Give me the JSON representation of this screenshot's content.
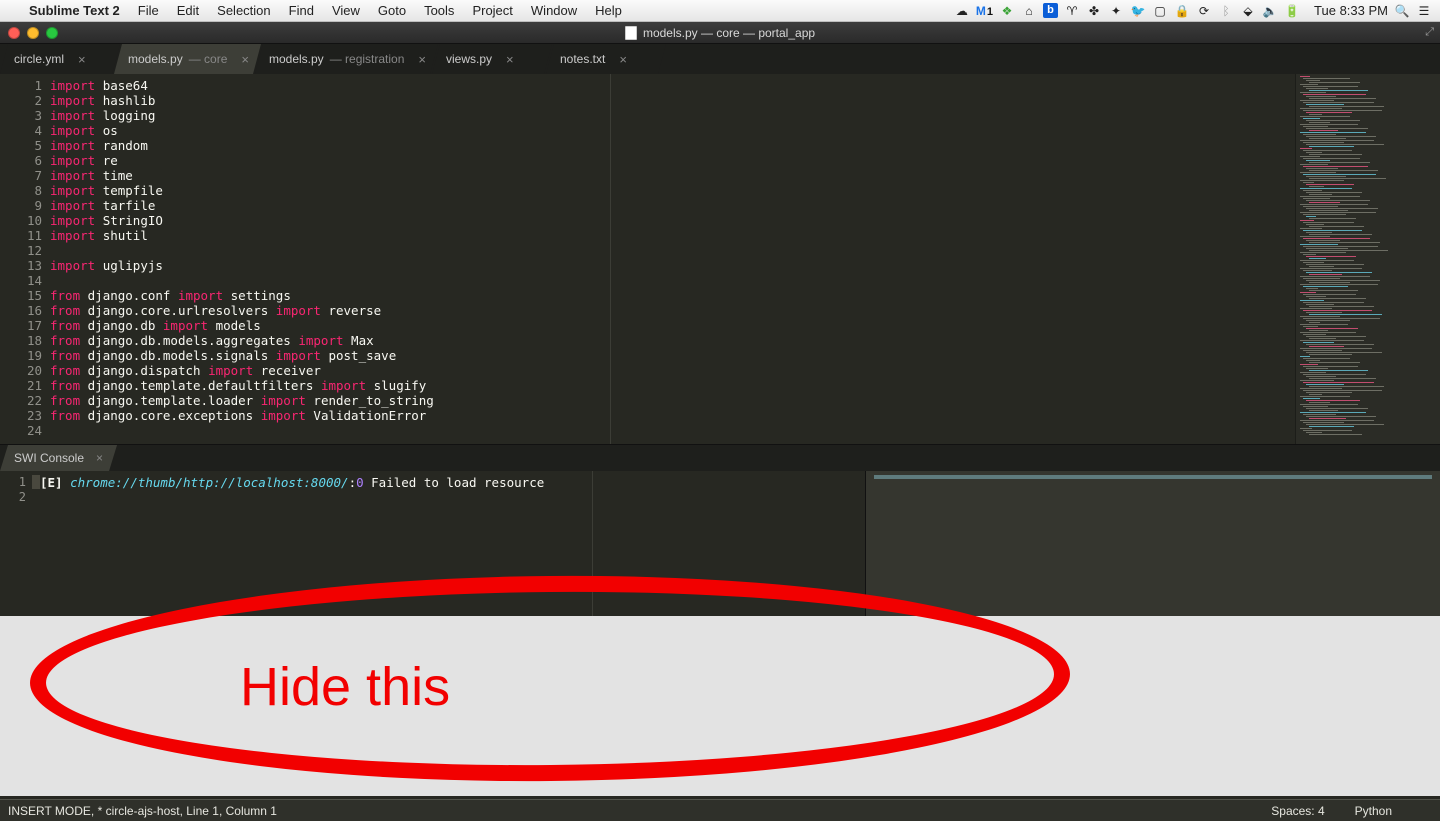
{
  "menubar": {
    "app": "Sublime Text 2",
    "items": [
      "File",
      "Edit",
      "Selection",
      "Find",
      "View",
      "Goto",
      "Tools",
      "Project",
      "Window",
      "Help"
    ],
    "gmail_badge": "1",
    "clock": "Tue 8:33 PM"
  },
  "window": {
    "title": "models.py — core — portal_app"
  },
  "tabs": [
    {
      "label": "circle.yml",
      "sub": "",
      "active": false
    },
    {
      "label": "models.py",
      "sub": " — core",
      "active": true
    },
    {
      "label": "models.py",
      "sub": " — registration",
      "active": false
    },
    {
      "label": "views.py",
      "sub": "",
      "active": false
    },
    {
      "label": "notes.txt",
      "sub": "",
      "active": false
    }
  ],
  "code_lines": [
    [
      {
        "t": "import ",
        "c": "kw-pink"
      },
      {
        "t": "base64",
        "c": "plain"
      }
    ],
    [
      {
        "t": "import ",
        "c": "kw-pink"
      },
      {
        "t": "hashlib",
        "c": "plain"
      }
    ],
    [
      {
        "t": "import ",
        "c": "kw-pink"
      },
      {
        "t": "logging",
        "c": "plain"
      }
    ],
    [
      {
        "t": "import ",
        "c": "kw-pink"
      },
      {
        "t": "os",
        "c": "plain"
      }
    ],
    [
      {
        "t": "import ",
        "c": "kw-pink"
      },
      {
        "t": "random",
        "c": "plain"
      }
    ],
    [
      {
        "t": "import ",
        "c": "kw-pink"
      },
      {
        "t": "re",
        "c": "plain"
      }
    ],
    [
      {
        "t": "import ",
        "c": "kw-pink"
      },
      {
        "t": "time",
        "c": "plain"
      }
    ],
    [
      {
        "t": "import ",
        "c": "kw-pink"
      },
      {
        "t": "tempfile",
        "c": "plain"
      }
    ],
    [
      {
        "t": "import ",
        "c": "kw-pink"
      },
      {
        "t": "tarfile",
        "c": "plain"
      }
    ],
    [
      {
        "t": "import ",
        "c": "kw-pink"
      },
      {
        "t": "StringIO",
        "c": "plain"
      }
    ],
    [
      {
        "t": "import ",
        "c": "kw-pink"
      },
      {
        "t": "shutil",
        "c": "plain"
      }
    ],
    [
      {
        "t": "",
        "c": "plain"
      }
    ],
    [
      {
        "t": "import ",
        "c": "kw-pink"
      },
      {
        "t": "uglipyjs",
        "c": "plain"
      }
    ],
    [
      {
        "t": "",
        "c": "plain"
      }
    ],
    [
      {
        "t": "from ",
        "c": "kw-pink"
      },
      {
        "t": "django.conf ",
        "c": "plain"
      },
      {
        "t": "import ",
        "c": "kw-pink"
      },
      {
        "t": "settings",
        "c": "plain"
      }
    ],
    [
      {
        "t": "from ",
        "c": "kw-pink"
      },
      {
        "t": "django.core.urlresolvers ",
        "c": "plain"
      },
      {
        "t": "import ",
        "c": "kw-pink"
      },
      {
        "t": "reverse",
        "c": "plain"
      }
    ],
    [
      {
        "t": "from ",
        "c": "kw-pink"
      },
      {
        "t": "django.db ",
        "c": "plain"
      },
      {
        "t": "import ",
        "c": "kw-pink"
      },
      {
        "t": "models",
        "c": "plain"
      }
    ],
    [
      {
        "t": "from ",
        "c": "kw-pink"
      },
      {
        "t": "django.db.models.aggregates ",
        "c": "plain"
      },
      {
        "t": "import ",
        "c": "kw-pink"
      },
      {
        "t": "Max",
        "c": "plain"
      }
    ],
    [
      {
        "t": "from ",
        "c": "kw-pink"
      },
      {
        "t": "django.db.models.signals ",
        "c": "plain"
      },
      {
        "t": "import ",
        "c": "kw-pink"
      },
      {
        "t": "post_save",
        "c": "plain"
      }
    ],
    [
      {
        "t": "from ",
        "c": "kw-pink"
      },
      {
        "t": "django.dispatch ",
        "c": "plain"
      },
      {
        "t": "import ",
        "c": "kw-pink"
      },
      {
        "t": "receiver",
        "c": "plain"
      }
    ],
    [
      {
        "t": "from ",
        "c": "kw-pink"
      },
      {
        "t": "django.template.defaultfilters ",
        "c": "plain"
      },
      {
        "t": "import ",
        "c": "kw-pink"
      },
      {
        "t": "slugify",
        "c": "plain"
      }
    ],
    [
      {
        "t": "from ",
        "c": "kw-pink"
      },
      {
        "t": "django.template.loader ",
        "c": "plain"
      },
      {
        "t": "import ",
        "c": "kw-pink"
      },
      {
        "t": "render_to_string",
        "c": "plain"
      }
    ],
    [
      {
        "t": "from ",
        "c": "kw-pink"
      },
      {
        "t": "django.core.exceptions ",
        "c": "plain"
      },
      {
        "t": "import ",
        "c": "kw-pink"
      },
      {
        "t": "ValidationError",
        "c": "plain"
      }
    ],
    [
      {
        "t": "",
        "c": "plain"
      }
    ]
  ],
  "console": {
    "tab": "SWI Console",
    "line1": {
      "prefix": "[E] ",
      "url": "chrome://thumb/http://localhost:8000/",
      "colon": ":",
      "zero": "0",
      "msg": " Failed to load resource"
    }
  },
  "annotation": {
    "text": "Hide this"
  },
  "statusbar": {
    "left": "INSERT MODE, * circle-ajs-host, Line 1, Column 1",
    "spaces": "Spaces: 4",
    "lang": "Python"
  },
  "colors": {
    "bg": "#272822",
    "keyword": "#f92672",
    "italic_blue": "#66d9ef",
    "annotation": "#f20000"
  }
}
